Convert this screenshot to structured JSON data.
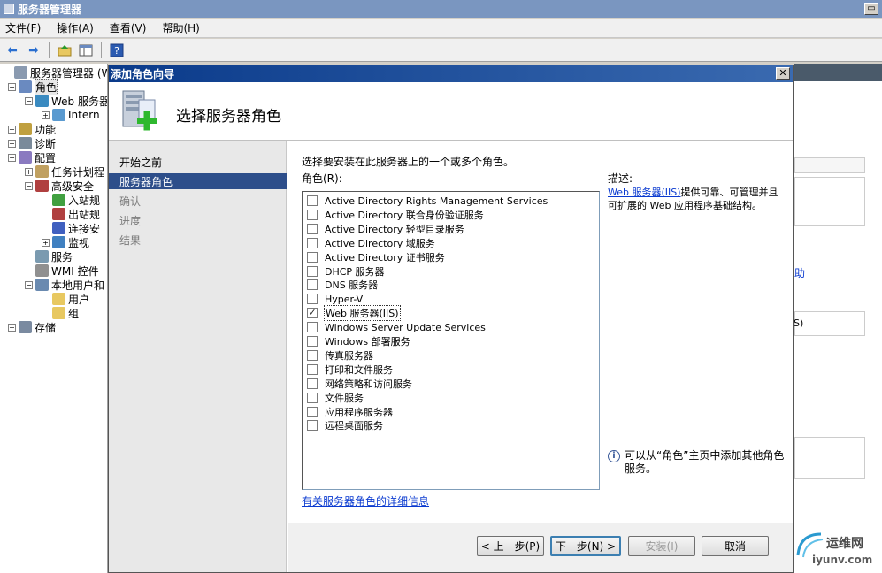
{
  "window": {
    "title": "服务器管理器"
  },
  "menu": [
    "文件(F)",
    "操作(A)",
    "查看(V)",
    "帮助(H)"
  ],
  "tree": [
    {
      "label": "服务器管理器 (W",
      "indent": 0,
      "exp": ""
    },
    {
      "label": "角色",
      "indent": 1,
      "exp": "−"
    },
    {
      "label": "Web 服务器",
      "indent": 2,
      "exp": "−"
    },
    {
      "label": "Intern",
      "indent": 3,
      "exp": "+"
    },
    {
      "label": "功能",
      "indent": 1,
      "exp": "+"
    },
    {
      "label": "诊断",
      "indent": 1,
      "exp": "+"
    },
    {
      "label": "配置",
      "indent": 1,
      "exp": "−"
    },
    {
      "label": "任务计划程",
      "indent": 2,
      "exp": "+"
    },
    {
      "label": "高级安全",
      "indent": 2,
      "exp": "−"
    },
    {
      "label": "入站规",
      "indent": 3,
      "exp": ""
    },
    {
      "label": "出站规",
      "indent": 3,
      "exp": ""
    },
    {
      "label": "连接安",
      "indent": 3,
      "exp": ""
    },
    {
      "label": "监视",
      "indent": 3,
      "exp": "+"
    },
    {
      "label": "服务",
      "indent": 2,
      "exp": ""
    },
    {
      "label": "WMI 控件",
      "indent": 2,
      "exp": ""
    },
    {
      "label": "本地用户和",
      "indent": 2,
      "exp": "−"
    },
    {
      "label": "用户",
      "indent": 3,
      "exp": ""
    },
    {
      "label": "组",
      "indent": 3,
      "exp": ""
    },
    {
      "label": "存储",
      "indent": 1,
      "exp": "+"
    }
  ],
  "right_pane": {
    "help_fragment": "助",
    "s_fragment": "S)"
  },
  "dialog": {
    "title": "添加角色向导",
    "close_label": "✕",
    "heading": "选择服务器角色",
    "steps": [
      {
        "label": "开始之前",
        "state": "done"
      },
      {
        "label": "服务器角色",
        "state": "active"
      },
      {
        "label": "确认",
        "state": "pending"
      },
      {
        "label": "进度",
        "state": "pending"
      },
      {
        "label": "结果",
        "state": "pending"
      }
    ],
    "intro": "选择要安装在此服务器上的一个或多个角色。",
    "roles_label": "角色(R):",
    "roles": [
      {
        "label": "Active Directory Rights Management Services",
        "checked": false
      },
      {
        "label": "Active Directory 联合身份验证服务",
        "checked": false
      },
      {
        "label": "Active Directory 轻型目录服务",
        "checked": false
      },
      {
        "label": "Active Directory 域服务",
        "checked": false
      },
      {
        "label": "Active Directory 证书服务",
        "checked": false
      },
      {
        "label": "DHCP 服务器",
        "checked": false
      },
      {
        "label": "DNS 服务器",
        "checked": false
      },
      {
        "label": "Hyper-V",
        "checked": false
      },
      {
        "label": "Web 服务器(IIS)",
        "checked": true,
        "selected": true
      },
      {
        "label": "Windows Server Update Services",
        "checked": false
      },
      {
        "label": "Windows 部署服务",
        "checked": false
      },
      {
        "label": "传真服务器",
        "checked": false
      },
      {
        "label": "打印和文件服务",
        "checked": false
      },
      {
        "label": "网络策略和访问服务",
        "checked": false
      },
      {
        "label": "文件服务",
        "checked": false
      },
      {
        "label": "应用程序服务器",
        "checked": false
      },
      {
        "label": "远程桌面服务",
        "checked": false
      }
    ],
    "more_link": "有关服务器角色的详细信息",
    "description_title": "描述:",
    "description_link": "Web 服务器(IIS)",
    "description_text": "提供可靠、可管理并且可扩展的 Web 应用程序基础结构。",
    "note": "可以从“角色”主页中添加其他角色服务。",
    "buttons": {
      "prev": "< 上一步(P)",
      "next": "下一步(N) >",
      "install": "安装(I)",
      "cancel": "取消"
    }
  },
  "watermark": {
    "name": "运维网",
    "url": "iyunv.com"
  }
}
